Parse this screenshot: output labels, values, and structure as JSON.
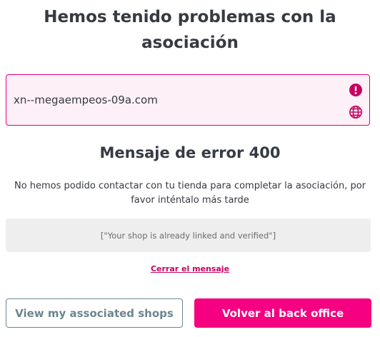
{
  "header": {
    "title": "Hemos tenido problemas con la asociación"
  },
  "domain_field": {
    "value": "xn--megaempeos-09a.com",
    "status_icon": "alert-circle-icon",
    "type_icon": "globe-icon"
  },
  "error": {
    "title": "Mensaje de error 400",
    "description": "No hemos podido contactar con tu tienda para completar la asociación, por favor inténtalo más tarde",
    "message": "[\"Your shop is already linked and verified\"]"
  },
  "actions": {
    "close_message_label": "Cerrar el mensaje",
    "view_shops_label": "View my associated shops",
    "back_office_label": "Volver al back office"
  },
  "colors": {
    "accent": "#f50080",
    "accent_dark": "#c6005f",
    "field_background": "#fdf0f6",
    "secondary": "#6c868e",
    "text": "#363a41"
  }
}
